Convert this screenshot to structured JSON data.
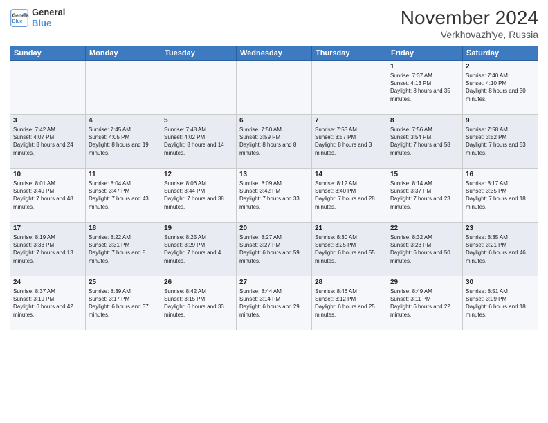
{
  "logo": {
    "line1": "General",
    "line2": "Blue"
  },
  "title": "November 2024",
  "subtitle": "Verkhovazh'ye, Russia",
  "weekdays": [
    "Sunday",
    "Monday",
    "Tuesday",
    "Wednesday",
    "Thursday",
    "Friday",
    "Saturday"
  ],
  "weeks": [
    [
      {
        "day": "",
        "info": ""
      },
      {
        "day": "",
        "info": ""
      },
      {
        "day": "",
        "info": ""
      },
      {
        "day": "",
        "info": ""
      },
      {
        "day": "",
        "info": ""
      },
      {
        "day": "1",
        "info": "Sunrise: 7:37 AM\nSunset: 4:13 PM\nDaylight: 8 hours and 35 minutes."
      },
      {
        "day": "2",
        "info": "Sunrise: 7:40 AM\nSunset: 4:10 PM\nDaylight: 8 hours and 30 minutes."
      }
    ],
    [
      {
        "day": "3",
        "info": "Sunrise: 7:42 AM\nSunset: 4:07 PM\nDaylight: 8 hours and 24 minutes."
      },
      {
        "day": "4",
        "info": "Sunrise: 7:45 AM\nSunset: 4:05 PM\nDaylight: 8 hours and 19 minutes."
      },
      {
        "day": "5",
        "info": "Sunrise: 7:48 AM\nSunset: 4:02 PM\nDaylight: 8 hours and 14 minutes."
      },
      {
        "day": "6",
        "info": "Sunrise: 7:50 AM\nSunset: 3:59 PM\nDaylight: 8 hours and 8 minutes."
      },
      {
        "day": "7",
        "info": "Sunrise: 7:53 AM\nSunset: 3:57 PM\nDaylight: 8 hours and 3 minutes."
      },
      {
        "day": "8",
        "info": "Sunrise: 7:56 AM\nSunset: 3:54 PM\nDaylight: 7 hours and 58 minutes."
      },
      {
        "day": "9",
        "info": "Sunrise: 7:58 AM\nSunset: 3:52 PM\nDaylight: 7 hours and 53 minutes."
      }
    ],
    [
      {
        "day": "10",
        "info": "Sunrise: 8:01 AM\nSunset: 3:49 PM\nDaylight: 7 hours and 48 minutes."
      },
      {
        "day": "11",
        "info": "Sunrise: 8:04 AM\nSunset: 3:47 PM\nDaylight: 7 hours and 43 minutes."
      },
      {
        "day": "12",
        "info": "Sunrise: 8:06 AM\nSunset: 3:44 PM\nDaylight: 7 hours and 38 minutes."
      },
      {
        "day": "13",
        "info": "Sunrise: 8:09 AM\nSunset: 3:42 PM\nDaylight: 7 hours and 33 minutes."
      },
      {
        "day": "14",
        "info": "Sunrise: 8:12 AM\nSunset: 3:40 PM\nDaylight: 7 hours and 28 minutes."
      },
      {
        "day": "15",
        "info": "Sunrise: 8:14 AM\nSunset: 3:37 PM\nDaylight: 7 hours and 23 minutes."
      },
      {
        "day": "16",
        "info": "Sunrise: 8:17 AM\nSunset: 3:35 PM\nDaylight: 7 hours and 18 minutes."
      }
    ],
    [
      {
        "day": "17",
        "info": "Sunrise: 8:19 AM\nSunset: 3:33 PM\nDaylight: 7 hours and 13 minutes."
      },
      {
        "day": "18",
        "info": "Sunrise: 8:22 AM\nSunset: 3:31 PM\nDaylight: 7 hours and 8 minutes."
      },
      {
        "day": "19",
        "info": "Sunrise: 8:25 AM\nSunset: 3:29 PM\nDaylight: 7 hours and 4 minutes."
      },
      {
        "day": "20",
        "info": "Sunrise: 8:27 AM\nSunset: 3:27 PM\nDaylight: 6 hours and 59 minutes."
      },
      {
        "day": "21",
        "info": "Sunrise: 8:30 AM\nSunset: 3:25 PM\nDaylight: 6 hours and 55 minutes."
      },
      {
        "day": "22",
        "info": "Sunrise: 8:32 AM\nSunset: 3:23 PM\nDaylight: 6 hours and 50 minutes."
      },
      {
        "day": "23",
        "info": "Sunrise: 8:35 AM\nSunset: 3:21 PM\nDaylight: 6 hours and 46 minutes."
      }
    ],
    [
      {
        "day": "24",
        "info": "Sunrise: 8:37 AM\nSunset: 3:19 PM\nDaylight: 6 hours and 42 minutes."
      },
      {
        "day": "25",
        "info": "Sunrise: 8:39 AM\nSunset: 3:17 PM\nDaylight: 6 hours and 37 minutes."
      },
      {
        "day": "26",
        "info": "Sunrise: 8:42 AM\nSunset: 3:15 PM\nDaylight: 6 hours and 33 minutes."
      },
      {
        "day": "27",
        "info": "Sunrise: 8:44 AM\nSunset: 3:14 PM\nDaylight: 6 hours and 29 minutes."
      },
      {
        "day": "28",
        "info": "Sunrise: 8:46 AM\nSunset: 3:12 PM\nDaylight: 6 hours and 25 minutes."
      },
      {
        "day": "29",
        "info": "Sunrise: 8:49 AM\nSunset: 3:11 PM\nDaylight: 6 hours and 22 minutes."
      },
      {
        "day": "30",
        "info": "Sunrise: 8:51 AM\nSunset: 3:09 PM\nDaylight: 6 hours and 18 minutes."
      }
    ]
  ]
}
